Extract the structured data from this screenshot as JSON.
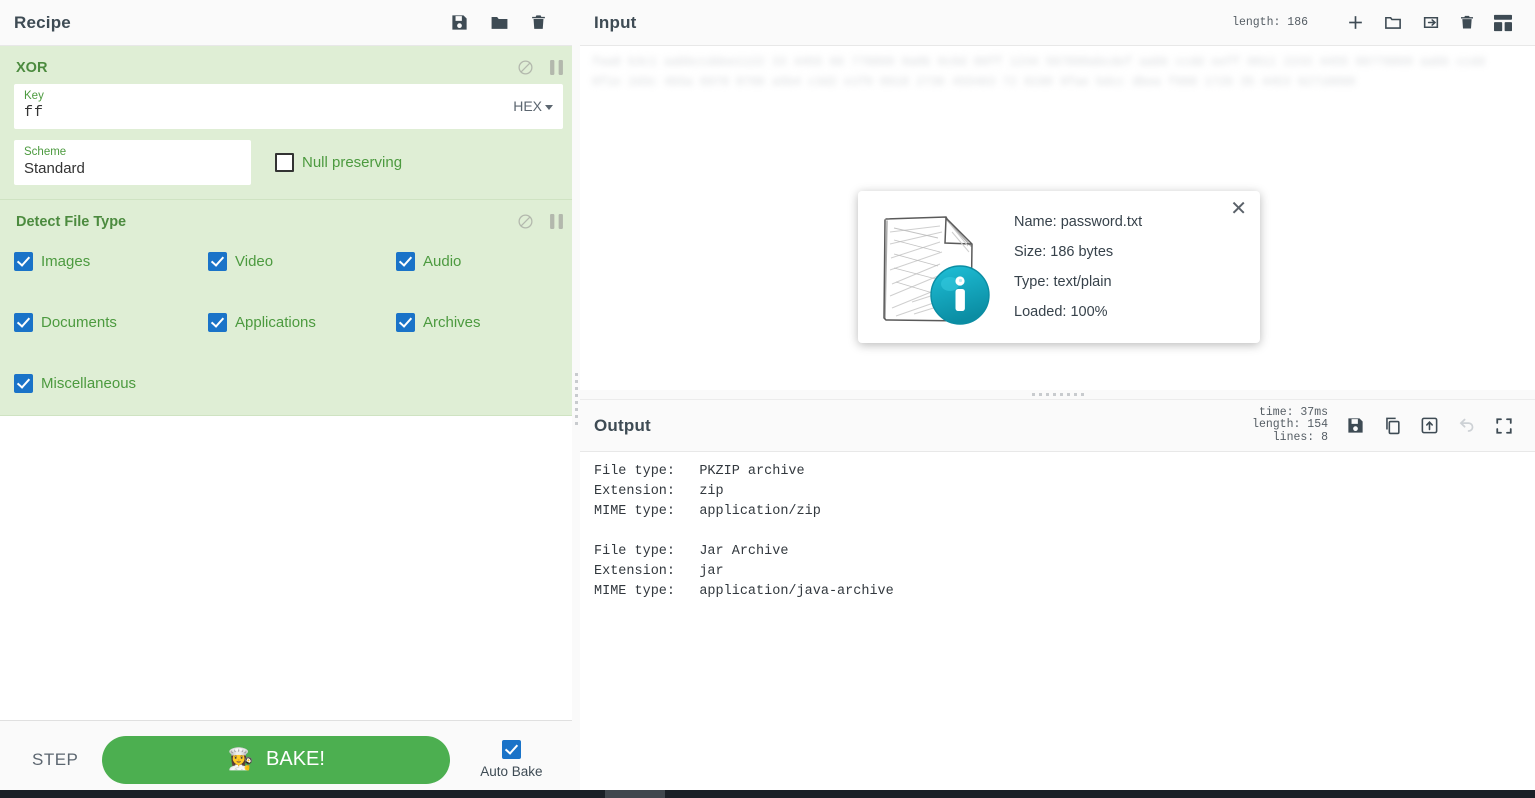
{
  "recipe": {
    "title": "Recipe",
    "header_icons": [
      {
        "name": "save-recipe-icon",
        "label": "Save recipe"
      },
      {
        "name": "load-recipe-icon",
        "label": "Load recipe"
      },
      {
        "name": "clear-recipe-icon",
        "label": "Clear recipe"
      }
    ],
    "operations": [
      {
        "name": "XOR",
        "controls": [
          {
            "name": "disable-operation-icon",
            "label": "Disable operation"
          },
          {
            "name": "pause-operation-icon",
            "label": "Set breakpoint"
          }
        ],
        "args": {
          "key_label": "Key",
          "key_value": "ff",
          "key_unit": "HEX",
          "scheme_label": "Scheme",
          "scheme_value": "Standard",
          "null_preserving_label": "Null preserving",
          "null_preserving_checked": false
        }
      },
      {
        "name": "Detect File Type",
        "controls": [
          {
            "name": "disable-operation-icon",
            "label": "Disable operation"
          },
          {
            "name": "pause-operation-icon",
            "label": "Set breakpoint"
          }
        ],
        "checkboxes": [
          {
            "label": "Images",
            "checked": true
          },
          {
            "label": "Video",
            "checked": true
          },
          {
            "label": "Audio",
            "checked": true
          },
          {
            "label": "Documents",
            "checked": true
          },
          {
            "label": "Applications",
            "checked": true
          },
          {
            "label": "Archives",
            "checked": true
          },
          {
            "label": "Miscellaneous",
            "checked": true
          }
        ]
      }
    ],
    "footer": {
      "step_label": "STEP",
      "bake_label": "BAKE!",
      "bake_emoji": "👩‍🍳",
      "auto_bake_label": "Auto Bake",
      "auto_bake_checked": true
    }
  },
  "input": {
    "title": "Input",
    "length_label": "length: 186",
    "ghost_text": "fea8 b3c1 aabbccddee1122 33 4455 66 778899 0a0b 0c0d 00ff 1234 567890abcdef aabb ccdd eeff 0011 2233 4455 66778899 aabb ccdd\n0f1e 2d3c 4b5a 6978 8796 a5b4 c3d2 e1f0 0918 2736 455463 72 8190 9fae bdcc dbea f908 1726 35 4453 62718090",
    "toolbar_icons": [
      {
        "name": "add-input-tab-icon",
        "label": "Add a new input tab"
      },
      {
        "name": "open-file-icon",
        "label": "Open file as input"
      },
      {
        "name": "open-folder-icon",
        "label": "Open folder as input"
      },
      {
        "name": "clear-input-icon",
        "label": "Clear input and output"
      },
      {
        "name": "reset-pane-layout-icon",
        "label": "Reset pane layout"
      }
    ],
    "file_card": {
      "close_label": "✕",
      "icon_name": "file-info-sketch-icon",
      "lines": [
        "Name: password.txt",
        "Size: 186 bytes",
        "Type: text/plain",
        "Loaded: 100%"
      ]
    }
  },
  "output": {
    "title": "Output",
    "meta": {
      "time": "time: 37ms",
      "length": "length:  154",
      "lines": "lines:     8"
    },
    "toolbar_icons": [
      {
        "name": "save-output-icon",
        "label": "Save output to file"
      },
      {
        "name": "copy-output-icon",
        "label": "Copy raw output to clipboard"
      },
      {
        "name": "replace-input-icon",
        "label": "Replace input with output"
      },
      {
        "name": "undo-bake-icon",
        "label": "Undo",
        "disabled": true
      },
      {
        "name": "maximise-output-icon",
        "label": "Maximise output pane"
      }
    ],
    "text": "File type:   PKZIP archive\nExtension:   zip\nMIME type:   application/zip\n\nFile type:   Jar Archive\nExtension:   jar\nMIME type:   application/java-archive"
  },
  "colors": {
    "operation_bg": "#dfeed5",
    "operation_title": "#4c8b3f",
    "checkbox_blue": "#1a73c8",
    "bake_green": "#4caf50",
    "info_badge_teal": "#12a3bb",
    "status_bar": "#1b2027"
  }
}
